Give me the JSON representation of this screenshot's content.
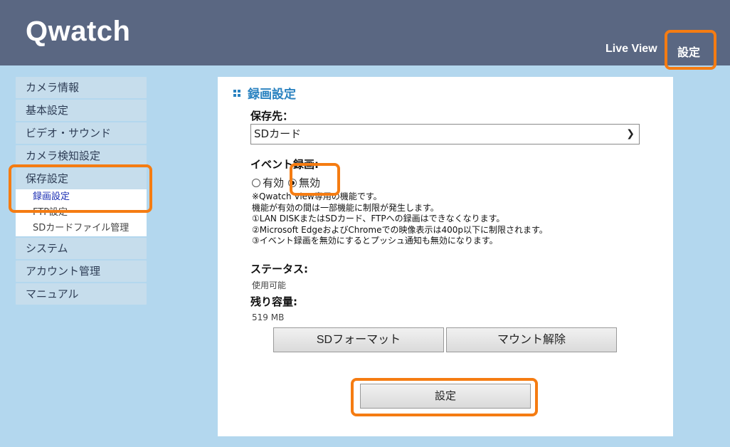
{
  "header": {
    "logo": "Qwatch",
    "nav": {
      "live_view": "Live View",
      "settings": "設定"
    }
  },
  "sidebar": {
    "items": [
      {
        "label": "カメラ情報"
      },
      {
        "label": "基本設定"
      },
      {
        "label": "ビデオ・サウンド"
      },
      {
        "label": "カメラ検知設定"
      },
      {
        "label": "保存設定",
        "children": [
          "録画設定",
          "FTP設定",
          "SDカードファイル管理"
        ]
      },
      {
        "label": "システム"
      },
      {
        "label": "アカウント管理"
      },
      {
        "label": "マニュアル"
      }
    ]
  },
  "panel": {
    "title": "録画設定",
    "save_dest_label": "保存先：",
    "save_dest_value": "SDカード",
    "event_label": "イベント録画:",
    "radio_on": "有効",
    "radio_off": "無効",
    "notes": [
      "※Qwatch View専用の機能です。",
      "機能が有効の間は一部機能に制限が発生します。",
      "①LAN DISKまたはSDカード、FTPへの録画はできなくなります。",
      "②Microsoft EdgeおよびChromeでの映像表示は400p以下に制限されます。",
      "③イベント録画を無効にするとプッシュ通知も無効になります。"
    ],
    "status_label": "ステータス:",
    "status_value": "使用可能",
    "capacity_label": "残り容量:",
    "capacity_value": "519 MB",
    "btn_format": "SDフォーマット",
    "btn_unmount": "マウント解除",
    "btn_submit": "設定"
  },
  "colors": {
    "header_bg": "#5a6782",
    "page_bg": "#b3d7ee",
    "accent": "#2a82c0",
    "highlight": "#f57c12"
  }
}
